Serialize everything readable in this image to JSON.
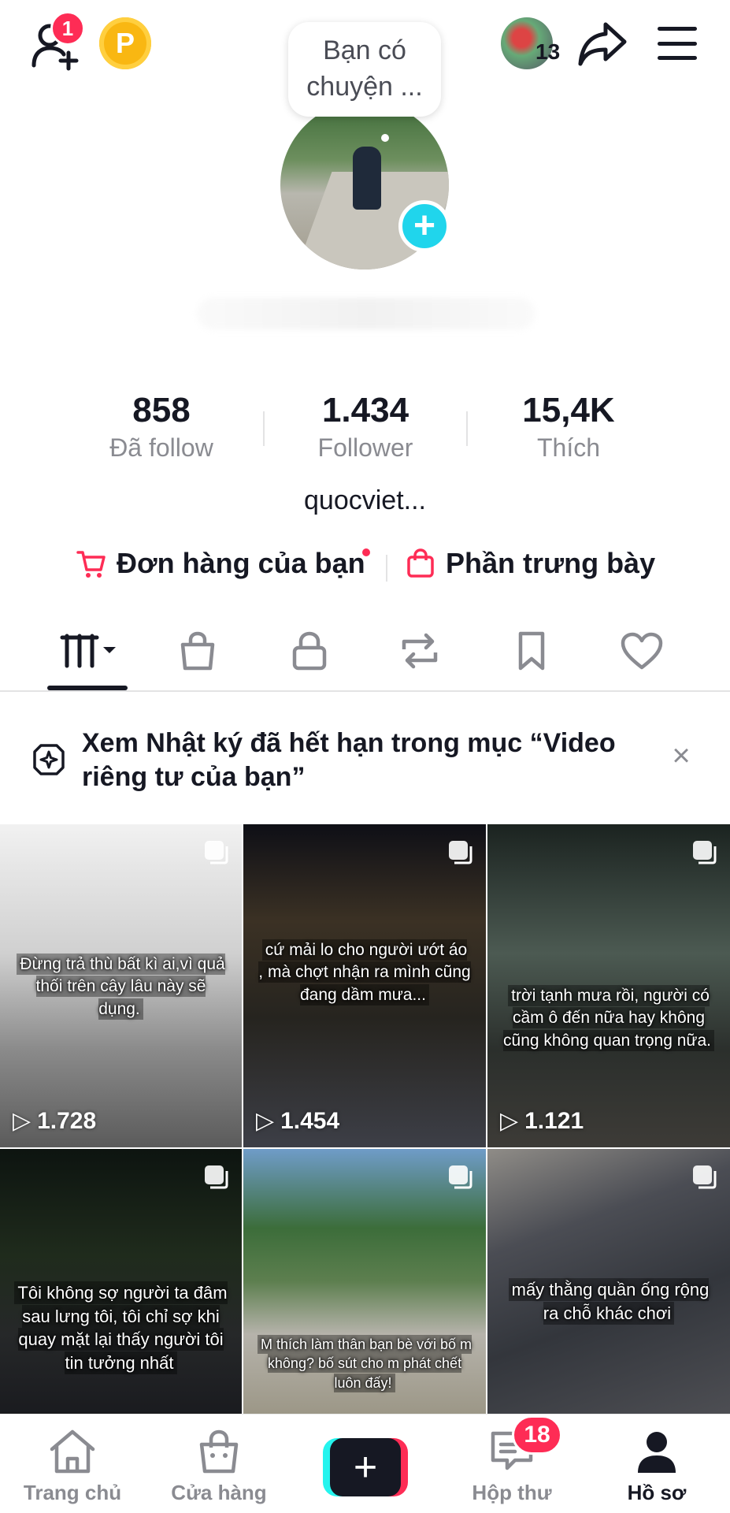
{
  "header": {
    "notification_count": "1",
    "coin_label": "P",
    "story_count": "13",
    "bubble_text": "Bạn có chuyện ..."
  },
  "stats": [
    {
      "value": "858",
      "label": "Đã follow"
    },
    {
      "value": "1.434",
      "label": "Follower"
    },
    {
      "value": "15,4K",
      "label": "Thích"
    }
  ],
  "bio": "quocviet...",
  "links": {
    "orders": "Đơn hàng của bạn",
    "showcase": "Phần trưng bày"
  },
  "notice": {
    "text": "Xem Nhật ký đã hết hạn trong mục “Video riêng tư của bạn”",
    "close": "×"
  },
  "videos": [
    {
      "caption": "Đừng trả thù bất kì ai,vì quả thối trên cây lâu này sẽ dụng.",
      "views": "1.728"
    },
    {
      "caption": "cứ mải lo cho người ướt áo , mà chợt nhận ra mình cũng đang dầm mưa...",
      "views": "1.454"
    },
    {
      "caption": "trời tạnh mưa rồi, người có cầm ô đến nữa hay không cũng không quan trọng nữa.",
      "views": "1.121"
    },
    {
      "caption": "Tôi không sợ người ta đâm sau lưng tôi, tôi chỉ sợ khi quay mặt lại thấy người tôi tin tưởng nhất",
      "views": ""
    },
    {
      "caption": "M thích làm thân bạn bè với bố m không? bố sút cho m phát chết luôn đấy!",
      "views": ""
    },
    {
      "caption": "mấy thằng quần ống rộng ra chỗ khác chơi",
      "views": ""
    }
  ],
  "nav": {
    "home": "Trang chủ",
    "shop": "Cửa hàng",
    "create": "+",
    "inbox": "Hộp thư",
    "inbox_badge": "18",
    "profile": "Hồ sơ"
  },
  "colors": {
    "accent": "#fe2c55",
    "cyan": "#20d5ec",
    "text": "#161823",
    "muted": "#8a8b91"
  }
}
